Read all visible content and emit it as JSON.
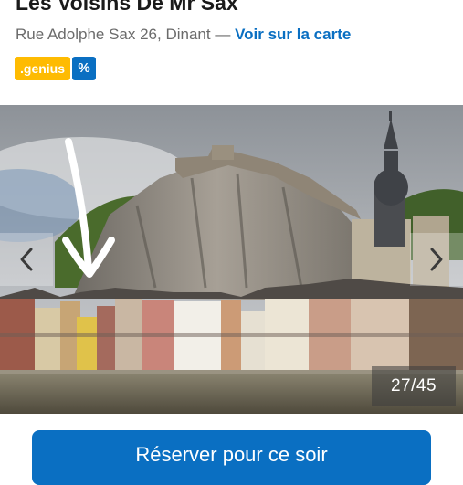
{
  "hotel": {
    "name": "Les Voisins De Mr Sax",
    "address": "Rue Adolphe Sax 26, Dinant",
    "separator": " — ",
    "map_link": "Voir sur la carte"
  },
  "badges": {
    "genius": ".genius",
    "percent": "%"
  },
  "gallery": {
    "counter": "27/45",
    "prev_icon": "chevron-left-icon",
    "next_icon": "chevron-right-icon",
    "annotation": "hand-drawn-arrow"
  },
  "cta": {
    "label": "Réserver pour ce soir"
  },
  "colors": {
    "brand_blue": "#0a6fc2",
    "genius_yellow": "#febb02"
  }
}
